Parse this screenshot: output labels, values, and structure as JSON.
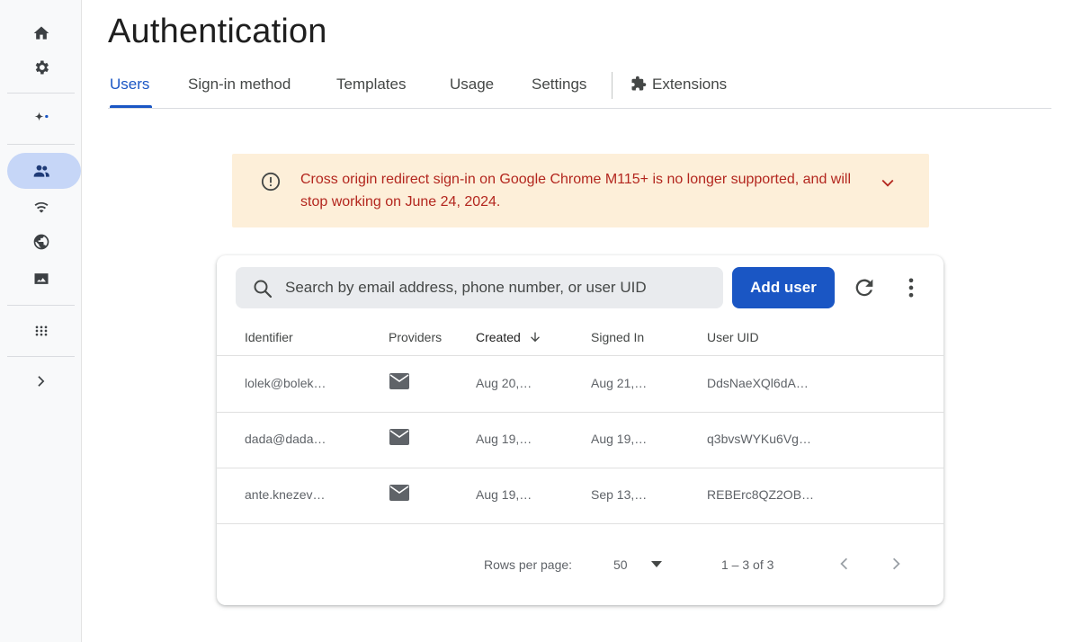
{
  "header": {
    "title": "Authentication"
  },
  "tabs": [
    {
      "label": "Users",
      "active": true
    },
    {
      "label": "Sign-in method"
    },
    {
      "label": "Templates"
    },
    {
      "label": "Usage"
    },
    {
      "label": "Settings"
    },
    {
      "label": "Extensions",
      "icon": "puzzle-icon"
    }
  ],
  "rail": {
    "icons": [
      "home-icon",
      "gear-icon",
      "sparkle-icon",
      "users-icon",
      "wifi-icon",
      "globe-icon",
      "photo-icon",
      "apps-grid-icon",
      "chevron-right-icon"
    ]
  },
  "banner": {
    "message": "Cross origin redirect sign-in on Google Chrome M115+ is no longer supported, and will stop working on June 24, 2024.",
    "color": "#b3261e",
    "background": "#fdefd9"
  },
  "search": {
    "placeholder": "Search by email address, phone number, or user UID"
  },
  "actions": {
    "add_user": "Add user"
  },
  "table": {
    "columns": [
      "Identifier",
      "Providers",
      "Created",
      "Signed In",
      "User UID"
    ],
    "sorted_column": "Created",
    "rows": [
      {
        "identifier": "lolek@bolek…",
        "provider": "mail-icon",
        "created": "Aug 20,…",
        "signed_in": "Aug 21,…",
        "uid": "DdsNaeXQl6dA…"
      },
      {
        "identifier": "dada@dada…",
        "provider": "mail-icon",
        "created": "Aug 19,…",
        "signed_in": "Aug 19,…",
        "uid": "q3bvsWYKu6Vg…"
      },
      {
        "identifier": "ante.knezev…",
        "provider": "mail-icon",
        "created": "Aug 19,…",
        "signed_in": "Sep 13,…",
        "uid": "REBErc8QZ2OB…"
      }
    ]
  },
  "pagination": {
    "rows_per_page_label": "Rows per page:",
    "rows_per_page": "50",
    "range": "1 – 3 of 3"
  },
  "colors": {
    "accent": "#1a56c4"
  }
}
